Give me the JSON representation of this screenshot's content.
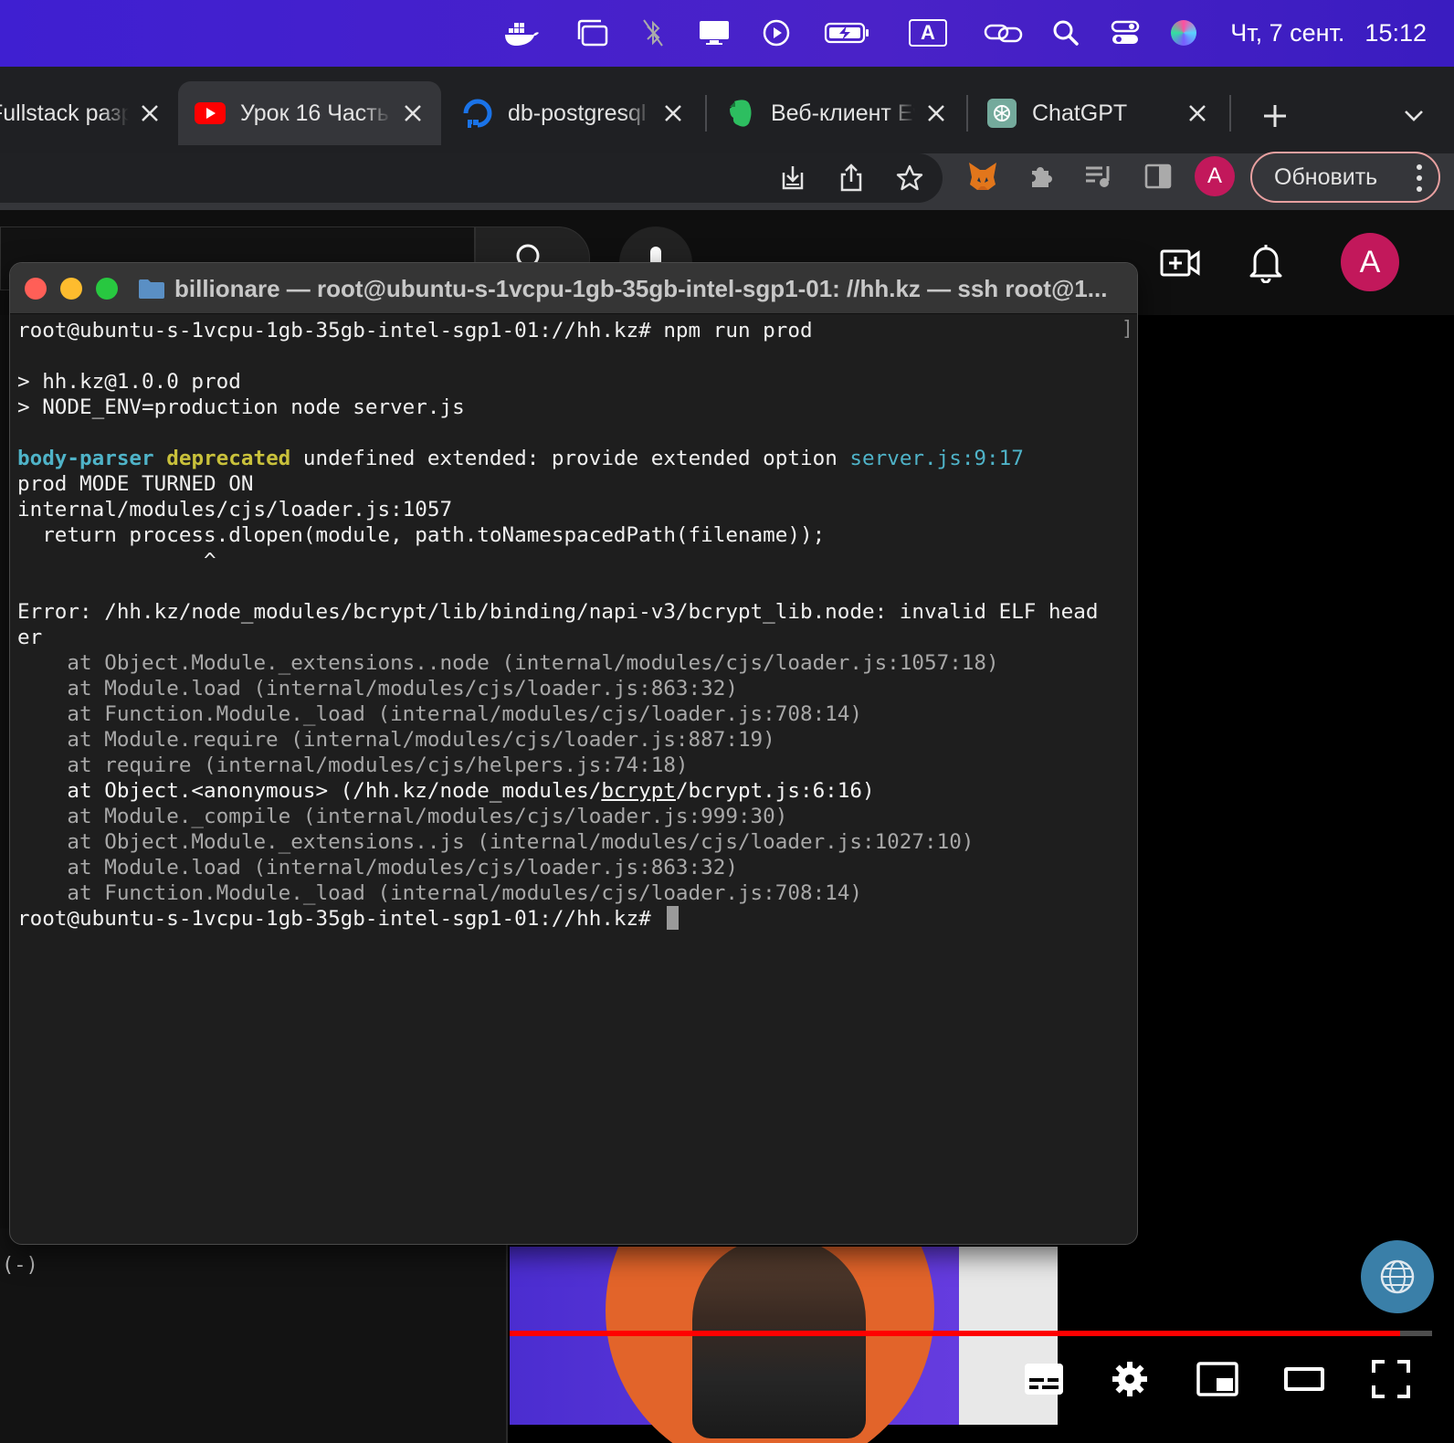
{
  "menubar": {
    "date": "Чт, 7 сент.",
    "time": "15:12",
    "input_source": "A",
    "icons": [
      "docker-icon",
      "window-icon",
      "bluetooth-off-icon",
      "display-icon",
      "play-circle-icon",
      "battery-charging-icon",
      "input-source-icon",
      "link-icon",
      "search-icon",
      "control-center-icon",
      "siri-icon"
    ]
  },
  "tabs": [
    {
      "title": "Fullstack разработчик",
      "favicon": "partial-icon",
      "active": false
    },
    {
      "title": "Урок 16 Часть",
      "favicon": "youtube-icon",
      "active": true
    },
    {
      "title": "db-postgresql",
      "favicon": "digitalocean-icon",
      "active": false
    },
    {
      "title": "Веб-клиент Evernote",
      "favicon": "evernote-icon",
      "active": false
    },
    {
      "title": "ChatGPT",
      "favicon": "chatgpt-icon",
      "active": false
    }
  ],
  "toolbar": {
    "profile_initial": "A",
    "update_label": "Обновить"
  },
  "youtube": {
    "avatar_initial": "A",
    "behind_text": "(-)",
    "progress": 0.965
  },
  "terminal": {
    "title": "billionare — root@ubuntu-s-1vcpu-1gb-35gb-intel-sgp1-01: //hh.kz — ssh root@1...",
    "lines": [
      {
        "text": "root@ubuntu-s-1vcpu-1gb-35gb-intel-sgp1-01://hh.kz# npm run prod"
      },
      {
        "text": ""
      },
      {
        "text": "> hh.kz@1.0.0 prod"
      },
      {
        "text": "> NODE_ENV=production node server.js"
      },
      {
        "text": ""
      },
      {
        "segments": [
          {
            "text": "body-parser",
            "cls": "c-cyan"
          },
          {
            "text": " ",
            "cls": ""
          },
          {
            "text": "deprecated",
            "cls": "c-yellow"
          },
          {
            "text": " undefined extended: provide extended option ",
            "cls": ""
          },
          {
            "text": "server.js:9:17",
            "cls": "c-link"
          }
        ]
      },
      {
        "text": "prod MODE TURNED ON"
      },
      {
        "text": "internal/modules/cjs/loader.js:1057"
      },
      {
        "text": "  return process.dlopen(module, path.toNamespacedPath(filename));"
      },
      {
        "text": "               ^"
      },
      {
        "text": ""
      },
      {
        "text": "Error: /hh.kz/node_modules/bcrypt/lib/binding/napi-v3/bcrypt_lib.node: invalid ELF head"
      },
      {
        "text": "er"
      },
      {
        "text": "    at Object.Module._extensions..node (internal/modules/cjs/loader.js:1057:18)",
        "cls": "c-dim"
      },
      {
        "text": "    at Module.load (internal/modules/cjs/loader.js:863:32)",
        "cls": "c-dim"
      },
      {
        "text": "    at Function.Module._load (internal/modules/cjs/loader.js:708:14)",
        "cls": "c-dim"
      },
      {
        "text": "    at Module.require (internal/modules/cjs/loader.js:887:19)",
        "cls": "c-dim"
      },
      {
        "text": "    at require (internal/modules/cjs/helpers.js:74:18)",
        "cls": "c-dim"
      },
      {
        "segments": [
          {
            "text": "    at Object.<anonymous> (/hh.kz/node_modules/",
            "cls": "c-bright"
          },
          {
            "text": "bcrypt",
            "cls": "c-bright underline"
          },
          {
            "text": "/bcrypt.js:6:16)",
            "cls": "c-bright"
          }
        ]
      },
      {
        "text": "    at Module._compile (internal/modules/cjs/loader.js:999:30)",
        "cls": "c-dim"
      },
      {
        "text": "    at Object.Module._extensions..js (internal/modules/cjs/loader.js:1027:10)",
        "cls": "c-dim"
      },
      {
        "text": "    at Module.load (internal/modules/cjs/loader.js:863:32)",
        "cls": "c-dim"
      },
      {
        "text": "    at Function.Module._load (internal/modules/cjs/loader.js:708:14)",
        "cls": "c-dim"
      },
      {
        "text": "root@ubuntu-s-1vcpu-1gb-35gb-intel-sgp1-01://hh.kz# ",
        "cursor": true
      }
    ]
  }
}
